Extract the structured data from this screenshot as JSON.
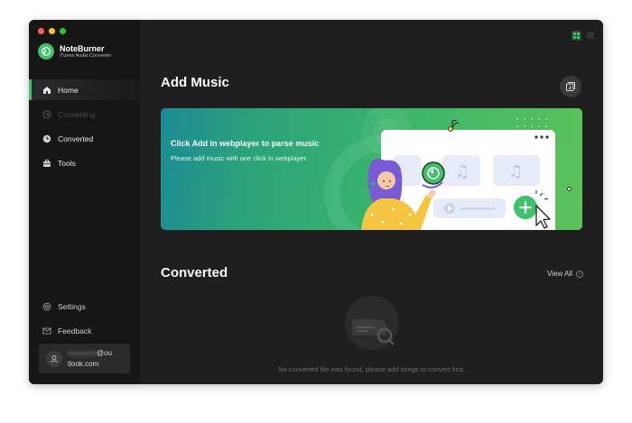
{
  "window": {
    "traffic_lights": [
      "#ff5f57",
      "#febc2e",
      "#28c840"
    ]
  },
  "brand": {
    "name": "NoteBurner",
    "subtitle": "iTunes Audio Converter",
    "accent": "#3ec16b"
  },
  "sidebar": {
    "items": [
      {
        "label": "Home",
        "icon": "home-icon",
        "active": true
      },
      {
        "label": "Converting",
        "icon": "converting-icon",
        "disabled": true
      },
      {
        "label": "Converted",
        "icon": "clock-icon"
      },
      {
        "label": "Tools",
        "icon": "toolbox-icon"
      }
    ],
    "bottom_items": [
      {
        "label": "Settings",
        "icon": "gear-icon"
      },
      {
        "label": "Feedback",
        "icon": "mail-icon"
      }
    ]
  },
  "account": {
    "email_hidden": "xxxxxxxx",
    "email_suffix_1": "@ou",
    "email_suffix_2": "tlook.com"
  },
  "main": {
    "add_music_title": "Add Music",
    "banner": {
      "title": "Click Add in webplayer to parse music",
      "subtitle": "Please add music with one click in webplayer."
    },
    "converted_title": "Converted",
    "view_all_label": "View All",
    "empty_message": "No converted file was found, please add songs to convert first."
  }
}
